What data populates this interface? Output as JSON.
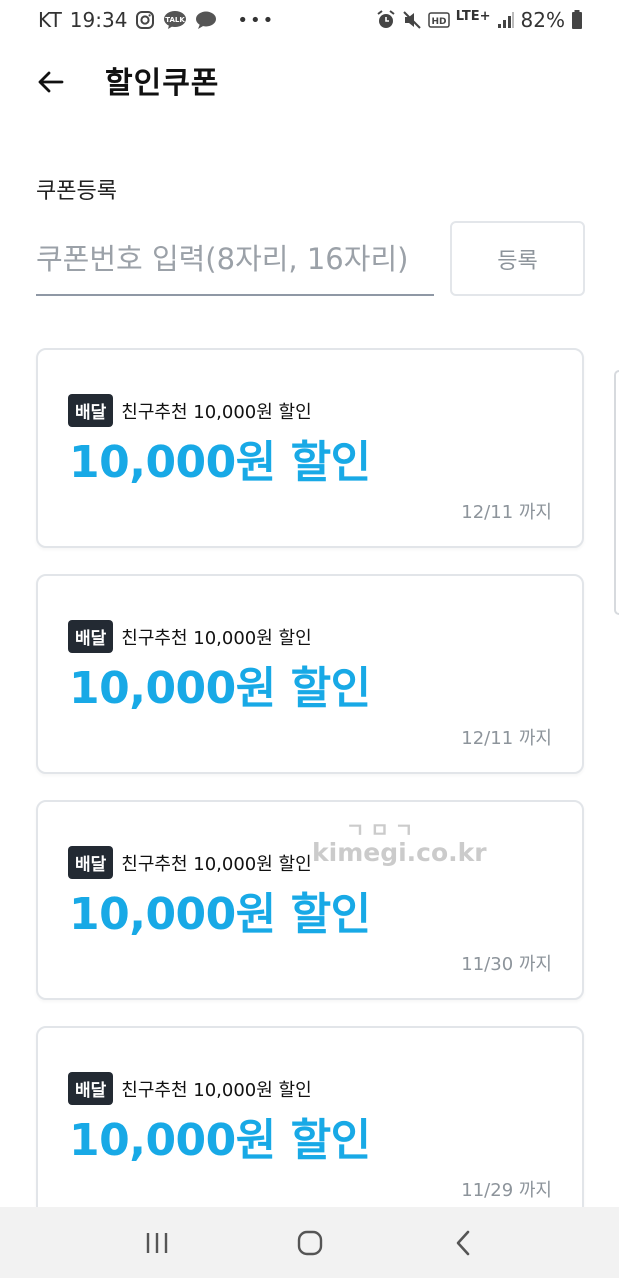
{
  "status_bar": {
    "carrier": "KT",
    "time": "19:34",
    "network": "LTE+",
    "battery": "82%"
  },
  "header": {
    "title": "할인쿠폰"
  },
  "register": {
    "label": "쿠폰등록",
    "placeholder": "쿠폰번호 입력(8자리, 16자리)",
    "value": "",
    "button_label": "등록"
  },
  "coupons": [
    {
      "badge": "배달",
      "description": "친구추천 10,000원 할인",
      "amount": "10,000원 할인",
      "expiry": "12/11 까지"
    },
    {
      "badge": "배달",
      "description": "친구추천 10,000원 할인",
      "amount": "10,000원 할인",
      "expiry": "12/11 까지"
    },
    {
      "badge": "배달",
      "description": "친구추천 10,000원 할인",
      "amount": "10,000원 할인",
      "expiry": "11/30 까지"
    },
    {
      "badge": "배달",
      "description": "친구추천 10,000원 할인",
      "amount": "10,000원 할인",
      "expiry": "11/29 까지"
    }
  ],
  "watermark": {
    "top": "ㄱㅁㄱ",
    "site": "kimegi.co.kr"
  },
  "colors": {
    "accent": "#18a9e6",
    "badge_bg": "#232a33",
    "card_border": "#e2e5e9",
    "nav_bg": "#f2f2f2"
  },
  "icons": [
    "back-arrow-icon",
    "instagram-icon",
    "kakaotalk-icon",
    "message-bubble-icon",
    "alarm-icon",
    "mute-icon",
    "hd-icon",
    "signal-icon",
    "battery-icon",
    "recent-apps-icon",
    "home-icon",
    "nav-back-icon"
  ]
}
